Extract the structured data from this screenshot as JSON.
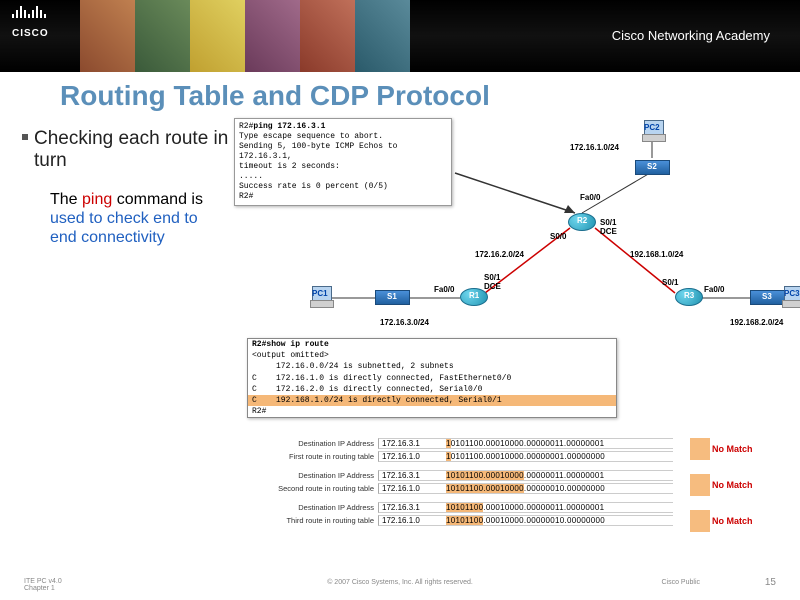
{
  "header": {
    "brand": "CISCO",
    "academy": "Cisco Networking Academy"
  },
  "title": "Routing Table and CDP Protocol",
  "bullet": "Checking each route in turn",
  "subtext": {
    "prefix": "The ",
    "ping": "ping",
    "mid": " command is ",
    "blue": "used to check end to end connectivity"
  },
  "terminal1": {
    "l1_prompt": "R2#",
    "l1_cmd": "ping 172.16.3.1",
    "l2": "Type escape sequence to abort.",
    "l3": "Sending 5, 100-byte ICMP Echos to 172.16.3.1,",
    "l4": "  timeout is 2 seconds:",
    "l5": ".....",
    "l6": "Success rate is 0 percent (0/5)",
    "l7": "R2#"
  },
  "diagram": {
    "pc1": "PC1",
    "pc2": "PC2",
    "pc3": "PC3",
    "s1": "S1",
    "s2": "S2",
    "s3": "S3",
    "r1": "R1",
    "r2": "R2",
    "r3": "R3",
    "fa00": "Fa0/0",
    "s00": "S0/0",
    "s01": "S0/1",
    "dce": "DCE",
    "net1": "172.16.1.0/24",
    "net2": "172.16.2.0/24",
    "net3": "192.168.1.0/24",
    "net4": "172.16.3.0/24",
    "net5": "192.168.2.0/24"
  },
  "terminal2": {
    "l1": "R2#show ip route",
    "l2": "<output omitted>",
    "l3": "     172.16.0.0/24 is subnetted, 2 subnets",
    "l4": "C    172.16.1.0 is directly connected, FastEthernet0/0",
    "l5": "C    172.16.2.0 is directly connected, Serial0/0",
    "l6": "C    192.168.1.0/24 is directly connected, Serial0/1",
    "l7": "R2#"
  },
  "matches": {
    "r1": {
      "label": "Destination IP Address",
      "ip": "172.16.3.1",
      "bin_a": "1",
      "bin_b": "0101100.00010000.00000011",
      "bin_c": ".00000001"
    },
    "r2": {
      "label": "First route in routing table",
      "ip": "172.16.1.0",
      "bin_a": "1",
      "bin_b": "0101100.00010000.00000001",
      "bin_c": ".00000000"
    },
    "r3": {
      "label": "Destination IP Address",
      "ip": "172.16.3.1",
      "bin_a": "10101100.00010000",
      "bin_b": ".00000011",
      "bin_c": ".00000001"
    },
    "r4": {
      "label": "Second route in routing table",
      "ip": "172.16.1.0",
      "bin_a": "10101100.00010000",
      "bin_b": ".00000010",
      "bin_c": ".00000000"
    },
    "r5": {
      "label": "Destination IP Address",
      "ip": "172.16.3.1",
      "bin_a": "10101100",
      "bin_b": ".00010000.00000011",
      "bin_c": ".00000001"
    },
    "r6": {
      "label": "Third route in routing table",
      "ip": "172.16.1.0",
      "bin_a": "10101100",
      "bin_b": ".00010000.00000010",
      "bin_c": ".00000000"
    },
    "nomatch": "No Match"
  },
  "footer": {
    "left1": "ITE PC v4.0",
    "left2": "Chapter 1",
    "center": "© 2007 Cisco Systems, Inc. All rights reserved.",
    "right": "Cisco Public",
    "page": "15"
  }
}
